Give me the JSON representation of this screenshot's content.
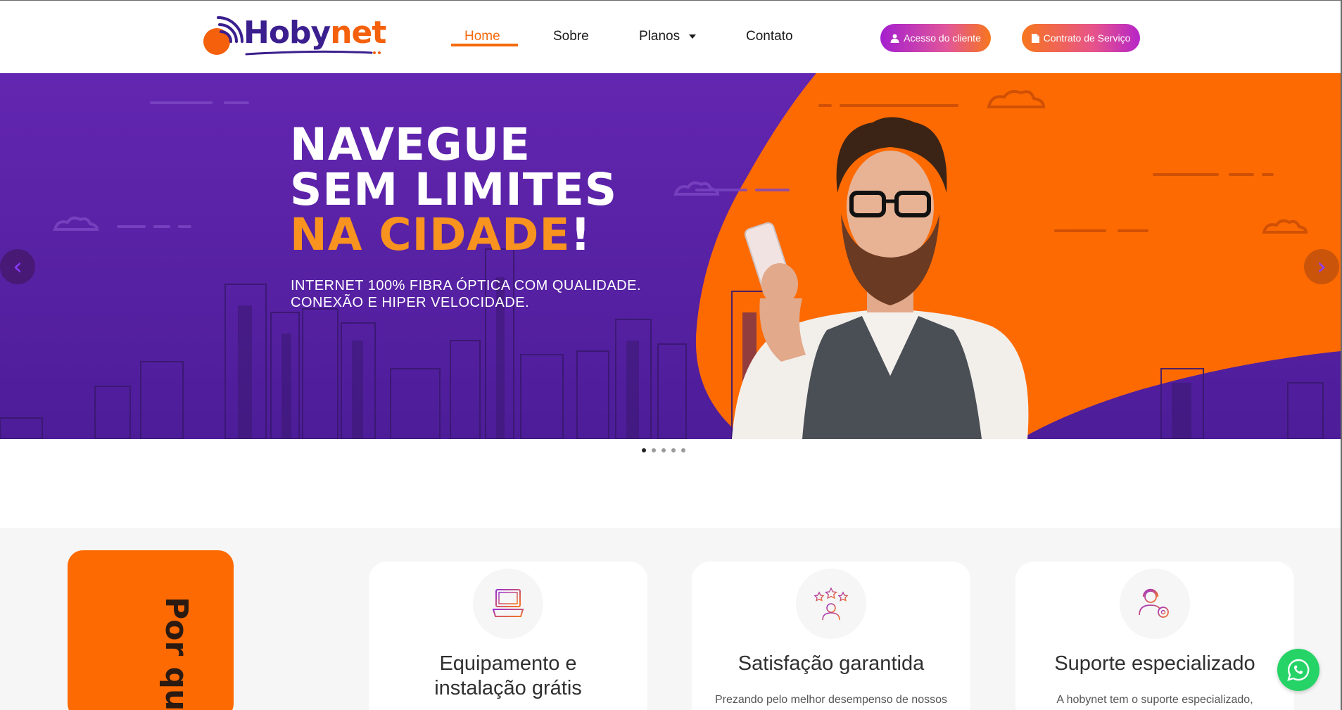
{
  "brand": {
    "logo_part1": "Hoby",
    "logo_part2": "net"
  },
  "nav": {
    "home": "Home",
    "sobre": "Sobre",
    "planos": "Planos",
    "contato": "Contato"
  },
  "header_buttons": {
    "cliente": "Acesso do cliente",
    "contrato": "Contrato de Serviço"
  },
  "hero": {
    "line1": "NAVEGUE",
    "line2": "SEM LIMITES",
    "line3_highlight": "NA CIDADE",
    "line3_suffix": "!",
    "sub1": "INTERNET 100% FIBRA ÓPTICA COM QUALIDADE.",
    "sub2": "CONEXÃO E HIPER VELOCIDADE."
  },
  "slider": {
    "slides": 5,
    "active": 1
  },
  "features": {
    "side_heading": "Por qu",
    "cards": [
      {
        "icon": "laptop-icon",
        "title_line1": "Equipamento e",
        "title_line2": "instalação grátis",
        "desc": ""
      },
      {
        "icon": "rating-stars-icon",
        "title_line1": "Satisfação garantida",
        "title_line2": "",
        "desc": "Prezando pelo melhor desempenso de nossos"
      },
      {
        "icon": "support-agent-icon",
        "title_line1": "Suporte especializado",
        "title_line2": "",
        "desc": "A hobynet tem o suporte especializado,"
      }
    ]
  },
  "colors": {
    "brand_purple": "#3b1f8e",
    "brand_orange": "#f46a0d",
    "hero_purple": "#5a22a6",
    "hero_orange": "#fd6a02",
    "whatsapp_green": "#25d366"
  }
}
